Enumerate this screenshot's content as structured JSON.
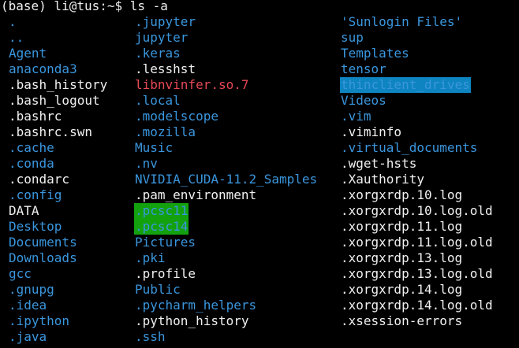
{
  "window": {
    "prompt": "(base) li@tus:~$",
    "command": "ls -a"
  },
  "colors": {
    "background": "#000000",
    "plain": "#f0f0f0",
    "dir": "#3a96dd",
    "error": "#e74856",
    "highlight_green": "#13a10e",
    "highlight_teal": "#0e84c0"
  },
  "listing": {
    "columns": [
      [
        {
          "name": ".",
          "type": "dir"
        },
        {
          "name": "..",
          "type": "dir"
        },
        {
          "name": "Agent",
          "type": "dir"
        },
        {
          "name": "anaconda3",
          "type": "dir"
        },
        {
          "name": ".bash_history",
          "type": "file"
        },
        {
          "name": ".bash_logout",
          "type": "file"
        },
        {
          "name": ".bashrc",
          "type": "file"
        },
        {
          "name": ".bashrc.swn",
          "type": "file"
        },
        {
          "name": ".cache",
          "type": "dir"
        },
        {
          "name": ".conda",
          "type": "dir"
        },
        {
          "name": ".condarc",
          "type": "file"
        },
        {
          "name": ".config",
          "type": "dir"
        },
        {
          "name": "DATA",
          "type": "file"
        },
        {
          "name": "Desktop",
          "type": "dir"
        },
        {
          "name": "Documents",
          "type": "dir"
        },
        {
          "name": "Downloads",
          "type": "dir"
        },
        {
          "name": "gcc",
          "type": "dir"
        },
        {
          "name": ".gnupg",
          "type": "dir"
        },
        {
          "name": ".idea",
          "type": "dir"
        },
        {
          "name": ".ipython",
          "type": "dir"
        },
        {
          "name": ".java",
          "type": "dir"
        }
      ],
      [
        {
          "name": ".jupyter",
          "type": "dir"
        },
        {
          "name": "jupyter",
          "type": "dir"
        },
        {
          "name": ".keras",
          "type": "dir"
        },
        {
          "name": ".lesshst",
          "type": "file"
        },
        {
          "name": "libnvinfer.so.7",
          "type": "broken"
        },
        {
          "name": ".local",
          "type": "dir"
        },
        {
          "name": ".modelscope",
          "type": "dir"
        },
        {
          "name": ".mozilla",
          "type": "dir"
        },
        {
          "name": "Music",
          "type": "dir"
        },
        {
          "name": ".nv",
          "type": "dir"
        },
        {
          "name": "NVIDIA_CUDA-11.2_Samples",
          "type": "dir"
        },
        {
          "name": ".pam_environment",
          "type": "file"
        },
        {
          "name": ".pcsc11",
          "type": "hl-green"
        },
        {
          "name": ".pcsc14",
          "type": "hl-green"
        },
        {
          "name": "Pictures",
          "type": "dir"
        },
        {
          "name": ".pki",
          "type": "dir"
        },
        {
          "name": ".profile",
          "type": "file"
        },
        {
          "name": "Public",
          "type": "dir"
        },
        {
          "name": ".pycharm_helpers",
          "type": "dir"
        },
        {
          "name": ".python_history",
          "type": "file"
        },
        {
          "name": ".ssh",
          "type": "dir"
        }
      ],
      [
        {
          "name": "'Sunlogin Files'",
          "type": "dir"
        },
        {
          "name": "sup",
          "type": "dir"
        },
        {
          "name": "Templates",
          "type": "dir"
        },
        {
          "name": "tensor",
          "type": "dir"
        },
        {
          "name": "thinclient_drives",
          "type": "hl-teal"
        },
        {
          "name": "Videos",
          "type": "dir"
        },
        {
          "name": ".vim",
          "type": "dir"
        },
        {
          "name": ".viminfo",
          "type": "file"
        },
        {
          "name": ".virtual_documents",
          "type": "dir"
        },
        {
          "name": ".wget-hsts",
          "type": "file"
        },
        {
          "name": ".Xauthority",
          "type": "file"
        },
        {
          "name": ".xorgxrdp.10.log",
          "type": "file"
        },
        {
          "name": ".xorgxrdp.10.log.old",
          "type": "file"
        },
        {
          "name": ".xorgxrdp.11.log",
          "type": "file"
        },
        {
          "name": ".xorgxrdp.11.log.old",
          "type": "file"
        },
        {
          "name": ".xorgxrdp.13.log",
          "type": "file"
        },
        {
          "name": ".xorgxrdp.13.log.old",
          "type": "file"
        },
        {
          "name": ".xorgxrdp.14.log",
          "type": "file"
        },
        {
          "name": ".xorgxrdp.14.log.old",
          "type": "file"
        },
        {
          "name": ".xsession-errors",
          "type": "file"
        }
      ]
    ]
  }
}
